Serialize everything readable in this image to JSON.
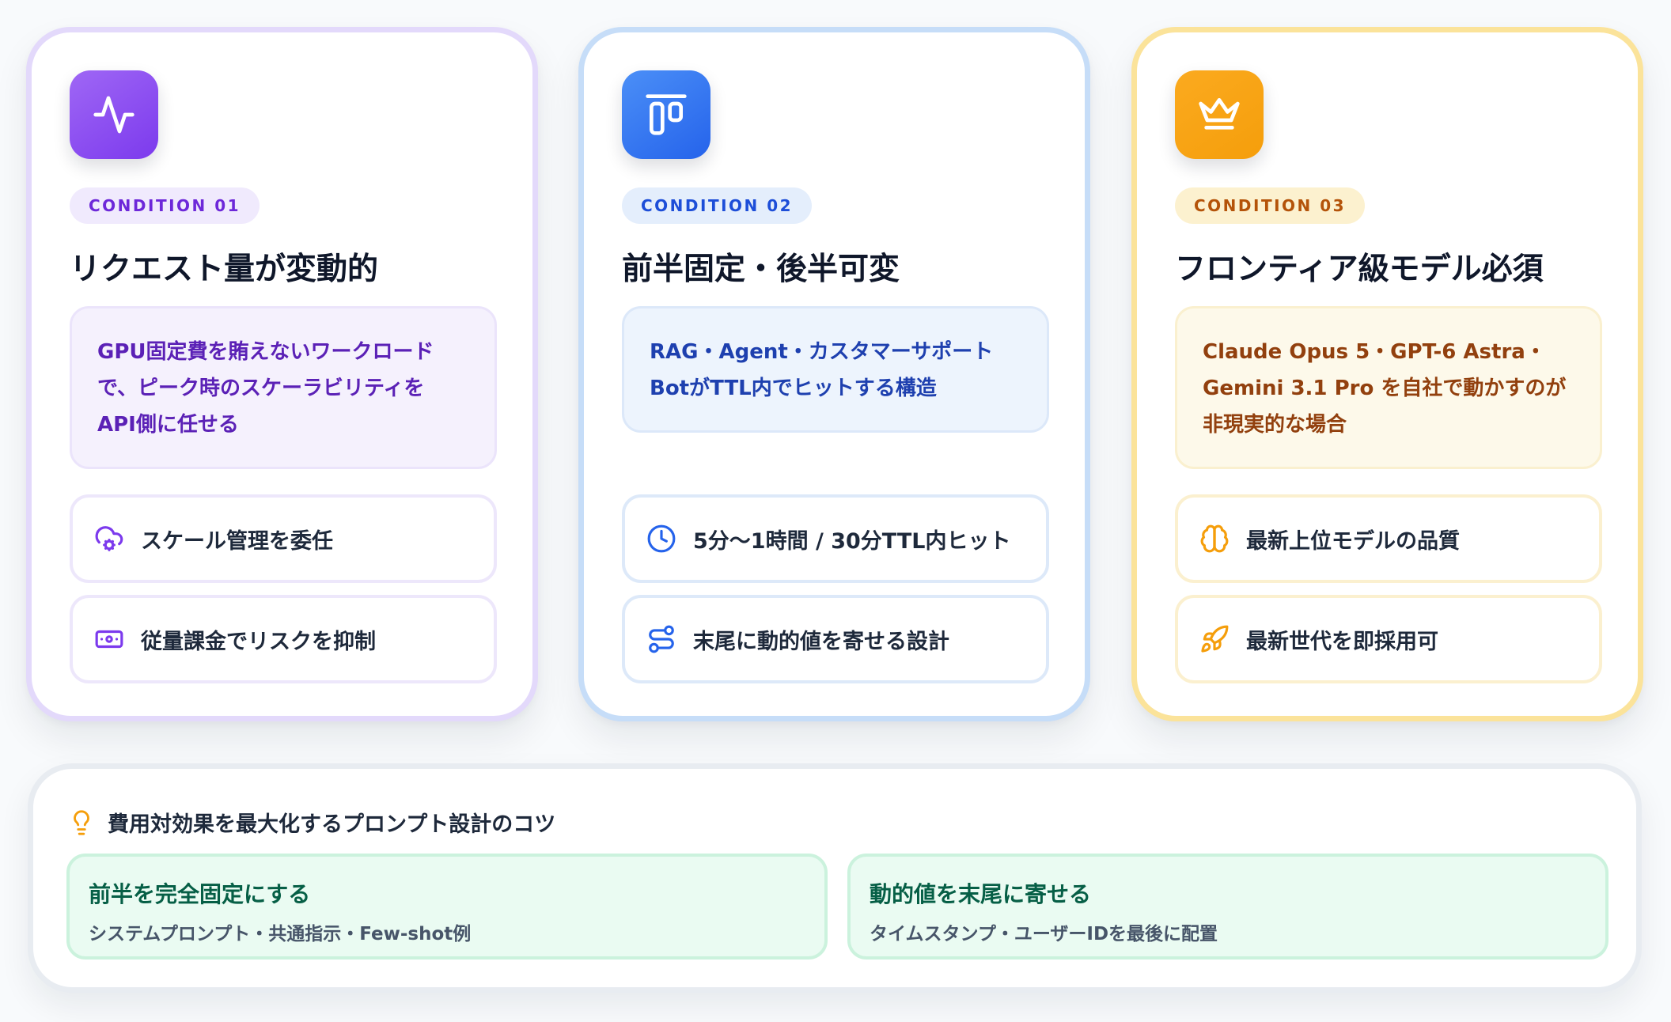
{
  "cards": [
    {
      "badge": "CONDITION 01",
      "title": "リクエスト量が変動的",
      "desc": {
        "line1": "GPU固定費を賄えないワークロード",
        "line2": "で、ピーク時のスケーラビリティを",
        "line3": "API側に任せる"
      },
      "icon": "activity-icon",
      "features": [
        {
          "icon": "cloud-cog-icon",
          "label": "スケール管理を委任"
        },
        {
          "icon": "banknote-icon",
          "label": "従量課金でリスクを抑制"
        }
      ]
    },
    {
      "badge": "CONDITION 02",
      "title": "前半固定・後半可変",
      "desc": {
        "line1": "RAG・Agent・カスタマーサポート",
        "line2": "BotがTTL内でヒットする構造"
      },
      "icon": "align-top-icon",
      "features": [
        {
          "icon": "clock-icon",
          "label": "5分〜1時間 / 30分TTL内ヒット"
        },
        {
          "icon": "route-icon",
          "label": "末尾に動的値を寄せる設計"
        }
      ]
    },
    {
      "badge": "CONDITION 03",
      "title": "フロンティア級モデル必須",
      "desc": {
        "line1": "Claude Opus 5・GPT-6 Astra・",
        "line2": "Gemini 3.1 Pro を自社で動かすのが",
        "line3": "非現実的な場合"
      },
      "icon": "crown-icon",
      "features": [
        {
          "icon": "brain-icon",
          "label": "最新上位モデルの品質"
        },
        {
          "icon": "rocket-icon",
          "label": "最新世代を即採用可"
        }
      ]
    }
  ],
  "tips": {
    "icon": "lightbulb-icon",
    "title": "費用対効果を最大化するプロンプト設計のコツ",
    "items": [
      {
        "title": "前半を完全固定にする",
        "sub": "システムプロンプト・共通指示・Few-shot例"
      },
      {
        "title": "動的値を末尾に寄せる",
        "sub": "タイムスタンプ・ユーザーIDを最後に配置"
      }
    ]
  },
  "colors": {
    "purple": "#7c3aed",
    "blue": "#2563eb",
    "amber": "#f59e0b",
    "green": "#065f46"
  }
}
